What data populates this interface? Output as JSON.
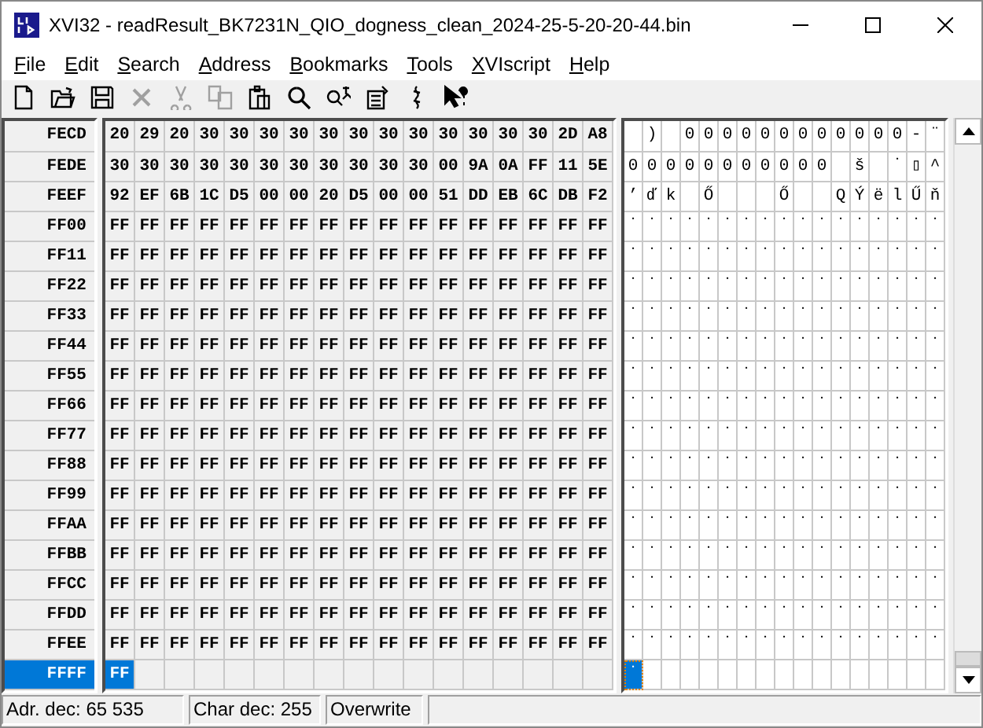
{
  "window": {
    "title": "XVI32 - readResult_BK7231N_QIO_dogness_clean_2024-25-5-20-20-44.bin"
  },
  "menu": [
    "File",
    "Edit",
    "Search",
    "Address",
    "Bookmarks",
    "Tools",
    "XVIscript",
    "Help"
  ],
  "toolbar": [
    {
      "disabled": false
    },
    {
      "disabled": false
    },
    {
      "disabled": false
    },
    {
      "disabled": true
    },
    {
      "disabled": true
    },
    {
      "disabled": true
    },
    {
      "disabled": false
    },
    {
      "disabled": false
    },
    {
      "disabled": false
    },
    {
      "disabled": false
    },
    {
      "disabled": false
    },
    {
      "disabled": false
    }
  ],
  "rows": [
    {
      "address": "FECD",
      "selected": false,
      "bytes": [
        "20",
        "29",
        "20",
        "30",
        "30",
        "30",
        "30",
        "30",
        "30",
        "30",
        "30",
        "30",
        "30",
        "30",
        "30",
        "2D",
        "A8"
      ],
      "chars": [
        {
          "kind": "blank"
        },
        ")",
        {
          "kind": "blank"
        },
        "0",
        "0",
        "0",
        "0",
        "0",
        "0",
        "0",
        "0",
        "0",
        "0",
        "0",
        "0",
        "-",
        "¨"
      ]
    },
    {
      "address": "FEDE",
      "selected": false,
      "bytes": [
        "30",
        "30",
        "30",
        "30",
        "30",
        "30",
        "30",
        "30",
        "30",
        "30",
        "30",
        "00",
        "9A",
        "0A",
        "FF",
        "11",
        "5E"
      ],
      "chars": [
        "0",
        "0",
        "0",
        "0",
        "0",
        "0",
        "0",
        "0",
        "0",
        "0",
        "0",
        {
          "kind": "blank"
        },
        "š",
        {
          "kind": "blank"
        },
        "˙",
        "▯",
        "^"
      ]
    },
    {
      "address": "FEEF",
      "selected": false,
      "bytes": [
        "92",
        "EF",
        "6B",
        "1C",
        "D5",
        "00",
        "00",
        "20",
        "D5",
        "00",
        "00",
        "51",
        "DD",
        "EB",
        "6C",
        "DB",
        "F2"
      ],
      "chars": [
        "’",
        "ď",
        "k",
        {
          "kind": "blank"
        },
        "Ő",
        {
          "kind": "blank"
        },
        {
          "kind": "blank"
        },
        {
          "kind": "blank"
        },
        "Ő",
        {
          "kind": "blank"
        },
        {
          "kind": "blank"
        },
        "Q",
        "Ý",
        "ë",
        "l",
        "Ű",
        "ň"
      ]
    },
    {
      "address": "FF00",
      "selected": false,
      "bytes": [
        "FF",
        "FF",
        "FF",
        "FF",
        "FF",
        "FF",
        "FF",
        "FF",
        "FF",
        "FF",
        "FF",
        "FF",
        "FF",
        "FF",
        "FF",
        "FF",
        "FF"
      ],
      "chars": [
        "˙",
        "˙",
        "˙",
        "˙",
        "˙",
        "˙",
        "˙",
        "˙",
        "˙",
        "˙",
        "˙",
        "˙",
        "˙",
        "˙",
        "˙",
        "˙",
        "˙"
      ]
    },
    {
      "address": "FF11",
      "selected": false,
      "bytes": [
        "FF",
        "FF",
        "FF",
        "FF",
        "FF",
        "FF",
        "FF",
        "FF",
        "FF",
        "FF",
        "FF",
        "FF",
        "FF",
        "FF",
        "FF",
        "FF",
        "FF"
      ],
      "chars": [
        "˙",
        "˙",
        "˙",
        "˙",
        "˙",
        "˙",
        "˙",
        "˙",
        "˙",
        "˙",
        "˙",
        "˙",
        "˙",
        "˙",
        "˙",
        "˙",
        "˙"
      ]
    },
    {
      "address": "FF22",
      "selected": false,
      "bytes": [
        "FF",
        "FF",
        "FF",
        "FF",
        "FF",
        "FF",
        "FF",
        "FF",
        "FF",
        "FF",
        "FF",
        "FF",
        "FF",
        "FF",
        "FF",
        "FF",
        "FF"
      ],
      "chars": [
        "˙",
        "˙",
        "˙",
        "˙",
        "˙",
        "˙",
        "˙",
        "˙",
        "˙",
        "˙",
        "˙",
        "˙",
        "˙",
        "˙",
        "˙",
        "˙",
        "˙"
      ]
    },
    {
      "address": "FF33",
      "selected": false,
      "bytes": [
        "FF",
        "FF",
        "FF",
        "FF",
        "FF",
        "FF",
        "FF",
        "FF",
        "FF",
        "FF",
        "FF",
        "FF",
        "FF",
        "FF",
        "FF",
        "FF",
        "FF"
      ],
      "chars": [
        "˙",
        "˙",
        "˙",
        "˙",
        "˙",
        "˙",
        "˙",
        "˙",
        "˙",
        "˙",
        "˙",
        "˙",
        "˙",
        "˙",
        "˙",
        "˙",
        "˙"
      ]
    },
    {
      "address": "FF44",
      "selected": false,
      "bytes": [
        "FF",
        "FF",
        "FF",
        "FF",
        "FF",
        "FF",
        "FF",
        "FF",
        "FF",
        "FF",
        "FF",
        "FF",
        "FF",
        "FF",
        "FF",
        "FF",
        "FF"
      ],
      "chars": [
        "˙",
        "˙",
        "˙",
        "˙",
        "˙",
        "˙",
        "˙",
        "˙",
        "˙",
        "˙",
        "˙",
        "˙",
        "˙",
        "˙",
        "˙",
        "˙",
        "˙"
      ]
    },
    {
      "address": "FF55",
      "selected": false,
      "bytes": [
        "FF",
        "FF",
        "FF",
        "FF",
        "FF",
        "FF",
        "FF",
        "FF",
        "FF",
        "FF",
        "FF",
        "FF",
        "FF",
        "FF",
        "FF",
        "FF",
        "FF"
      ],
      "chars": [
        "˙",
        "˙",
        "˙",
        "˙",
        "˙",
        "˙",
        "˙",
        "˙",
        "˙",
        "˙",
        "˙",
        "˙",
        "˙",
        "˙",
        "˙",
        "˙",
        "˙"
      ]
    },
    {
      "address": "FF66",
      "selected": false,
      "bytes": [
        "FF",
        "FF",
        "FF",
        "FF",
        "FF",
        "FF",
        "FF",
        "FF",
        "FF",
        "FF",
        "FF",
        "FF",
        "FF",
        "FF",
        "FF",
        "FF",
        "FF"
      ],
      "chars": [
        "˙",
        "˙",
        "˙",
        "˙",
        "˙",
        "˙",
        "˙",
        "˙",
        "˙",
        "˙",
        "˙",
        "˙",
        "˙",
        "˙",
        "˙",
        "˙",
        "˙"
      ]
    },
    {
      "address": "FF77",
      "selected": false,
      "bytes": [
        "FF",
        "FF",
        "FF",
        "FF",
        "FF",
        "FF",
        "FF",
        "FF",
        "FF",
        "FF",
        "FF",
        "FF",
        "FF",
        "FF",
        "FF",
        "FF",
        "FF"
      ],
      "chars": [
        "˙",
        "˙",
        "˙",
        "˙",
        "˙",
        "˙",
        "˙",
        "˙",
        "˙",
        "˙",
        "˙",
        "˙",
        "˙",
        "˙",
        "˙",
        "˙",
        "˙"
      ]
    },
    {
      "address": "FF88",
      "selected": false,
      "bytes": [
        "FF",
        "FF",
        "FF",
        "FF",
        "FF",
        "FF",
        "FF",
        "FF",
        "FF",
        "FF",
        "FF",
        "FF",
        "FF",
        "FF",
        "FF",
        "FF",
        "FF"
      ],
      "chars": [
        "˙",
        "˙",
        "˙",
        "˙",
        "˙",
        "˙",
        "˙",
        "˙",
        "˙",
        "˙",
        "˙",
        "˙",
        "˙",
        "˙",
        "˙",
        "˙",
        "˙"
      ]
    },
    {
      "address": "FF99",
      "selected": false,
      "bytes": [
        "FF",
        "FF",
        "FF",
        "FF",
        "FF",
        "FF",
        "FF",
        "FF",
        "FF",
        "FF",
        "FF",
        "FF",
        "FF",
        "FF",
        "FF",
        "FF",
        "FF"
      ],
      "chars": [
        "˙",
        "˙",
        "˙",
        "˙",
        "˙",
        "˙",
        "˙",
        "˙",
        "˙",
        "˙",
        "˙",
        "˙",
        "˙",
        "˙",
        "˙",
        "˙",
        "˙"
      ]
    },
    {
      "address": "FFAA",
      "selected": false,
      "bytes": [
        "FF",
        "FF",
        "FF",
        "FF",
        "FF",
        "FF",
        "FF",
        "FF",
        "FF",
        "FF",
        "FF",
        "FF",
        "FF",
        "FF",
        "FF",
        "FF",
        "FF"
      ],
      "chars": [
        "˙",
        "˙",
        "˙",
        "˙",
        "˙",
        "˙",
        "˙",
        "˙",
        "˙",
        "˙",
        "˙",
        "˙",
        "˙",
        "˙",
        "˙",
        "˙",
        "˙"
      ]
    },
    {
      "address": "FFBB",
      "selected": false,
      "bytes": [
        "FF",
        "FF",
        "FF",
        "FF",
        "FF",
        "FF",
        "FF",
        "FF",
        "FF",
        "FF",
        "FF",
        "FF",
        "FF",
        "FF",
        "FF",
        "FF",
        "FF"
      ],
      "chars": [
        "˙",
        "˙",
        "˙",
        "˙",
        "˙",
        "˙",
        "˙",
        "˙",
        "˙",
        "˙",
        "˙",
        "˙",
        "˙",
        "˙",
        "˙",
        "˙",
        "˙"
      ]
    },
    {
      "address": "FFCC",
      "selected": false,
      "bytes": [
        "FF",
        "FF",
        "FF",
        "FF",
        "FF",
        "FF",
        "FF",
        "FF",
        "FF",
        "FF",
        "FF",
        "FF",
        "FF",
        "FF",
        "FF",
        "FF",
        "FF"
      ],
      "chars": [
        "˙",
        "˙",
        "˙",
        "˙",
        "˙",
        "˙",
        "˙",
        "˙",
        "˙",
        "˙",
        "˙",
        "˙",
        "˙",
        "˙",
        "˙",
        "˙",
        "˙"
      ]
    },
    {
      "address": "FFDD",
      "selected": false,
      "bytes": [
        "FF",
        "FF",
        "FF",
        "FF",
        "FF",
        "FF",
        "FF",
        "FF",
        "FF",
        "FF",
        "FF",
        "FF",
        "FF",
        "FF",
        "FF",
        "FF",
        "FF"
      ],
      "chars": [
        "˙",
        "˙",
        "˙",
        "˙",
        "˙",
        "˙",
        "˙",
        "˙",
        "˙",
        "˙",
        "˙",
        "˙",
        "˙",
        "˙",
        "˙",
        "˙",
        "˙"
      ]
    },
    {
      "address": "FFEE",
      "selected": false,
      "bytes": [
        "FF",
        "FF",
        "FF",
        "FF",
        "FF",
        "FF",
        "FF",
        "FF",
        "FF",
        "FF",
        "FF",
        "FF",
        "FF",
        "FF",
        "FF",
        "FF",
        "FF"
      ],
      "chars": [
        "˙",
        "˙",
        "˙",
        "˙",
        "˙",
        "˙",
        "˙",
        "˙",
        "˙",
        "˙",
        "˙",
        "˙",
        "˙",
        "˙",
        "˙",
        "˙",
        "˙"
      ]
    },
    {
      "address": "FFFF",
      "selected": true,
      "bytes": [
        "FF"
      ],
      "chars": [
        "˙"
      ]
    }
  ],
  "status_bar": {
    "address": "Adr. dec: 65 535",
    "char": "Char dec: 255",
    "mode": "Overwrite"
  }
}
